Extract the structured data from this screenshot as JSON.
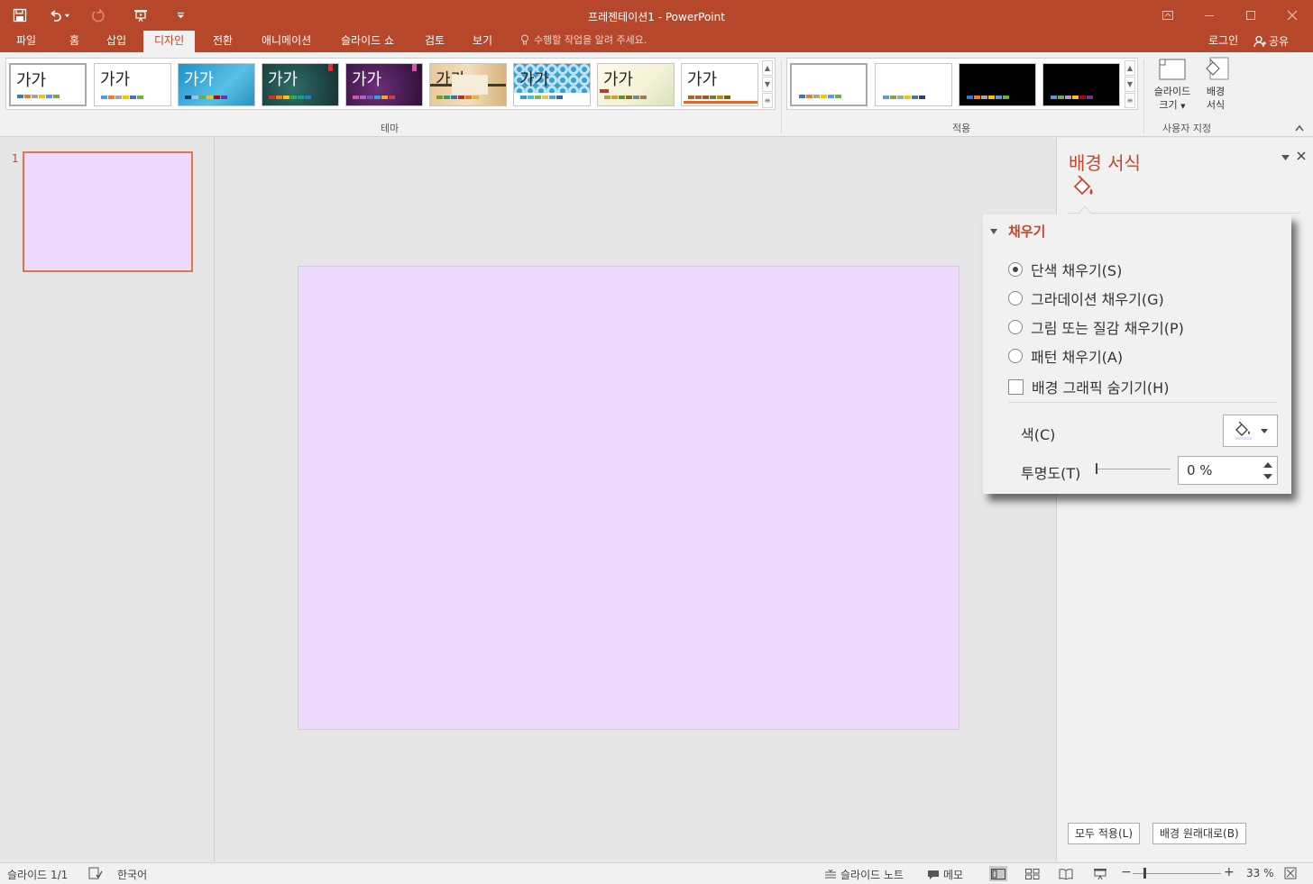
{
  "window": {
    "title": "프레젠테이션1 - PowerPoint"
  },
  "tabs": [
    {
      "label": "파일"
    },
    {
      "label": "홈"
    },
    {
      "label": "삽입"
    },
    {
      "label": "디자인",
      "active": true
    },
    {
      "label": "전환"
    },
    {
      "label": "애니메이션"
    },
    {
      "label": "슬라이드 쇼"
    },
    {
      "label": "검토"
    },
    {
      "label": "보기"
    }
  ],
  "tell_me": "수행할 작업을 알려 주세요.",
  "account": {
    "login": "로그인",
    "share": "공유"
  },
  "ribbon": {
    "themes_group_label": "테마",
    "theme_sample_text": "가가",
    "variants_group_label": "적용",
    "customize_group_label": "사용자 지정",
    "slide_size_label_1": "슬라이드",
    "slide_size_label_2": "크기",
    "format_bg_label_1": "배경",
    "format_bg_label_2": "서식"
  },
  "slides_pane": {
    "slide_number": "1"
  },
  "slide": {
    "background_color": "#eedafd"
  },
  "format_pane": {
    "title": "배경 서식",
    "section_title": "채우기",
    "options": {
      "solid": "단색 채우기(S)",
      "gradient": "그라데이션 채우기(G)",
      "picture": "그림 또는 질감 채우기(P)",
      "pattern": "패턴 채우기(A)",
      "hide_graphics": "배경 그래픽 숨기기(H)"
    },
    "selected_option": "solid",
    "hide_graphics_checked": false,
    "color_label": "색(C)",
    "transparency_label": "투명도(T)",
    "transparency_value": "0 %",
    "apply_all_button": "모두 적용(L)",
    "reset_button": "배경 원래대로(B)"
  },
  "status_bar": {
    "slide_count": "슬라이드 1/1",
    "language": "한국어",
    "notes": "슬라이드 노트",
    "comments": "메모",
    "zoom": "33 %"
  },
  "colors": {
    "accent": "#b7472a",
    "accent_text": "#c6472b",
    "ribbon_bg": "#f1f1f1",
    "workspace_bg": "#e6e6e6"
  }
}
